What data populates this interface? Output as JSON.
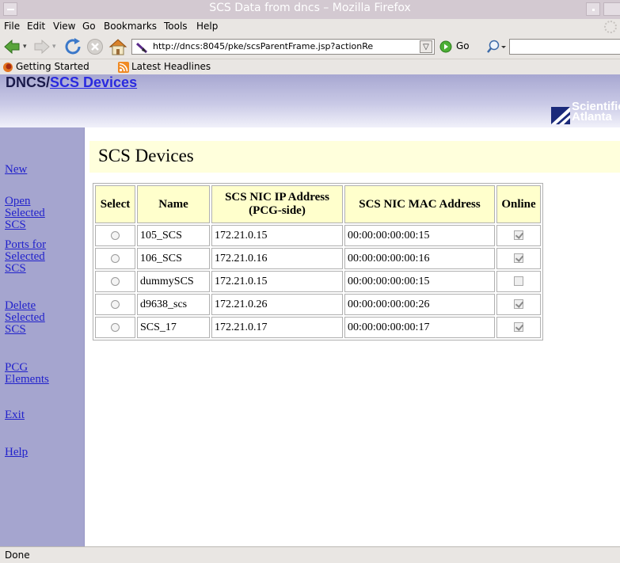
{
  "window": {
    "title": "SCS Data from dncs – Mozilla Firefox"
  },
  "menubar": {
    "items": [
      "File",
      "Edit",
      "View",
      "Go",
      "Bookmarks",
      "Tools",
      "Help"
    ]
  },
  "navbar": {
    "url": "http://dncs:8045/pke/scsParentFrame.jsp?actionRe",
    "go_label": "Go",
    "icons": [
      "back-arrow-icon",
      "forward-arrow-icon",
      "reload-icon",
      "stop-icon",
      "home-icon",
      "search-icon"
    ]
  },
  "bookmarks": {
    "items": [
      {
        "label": "Getting Started",
        "icon": "firefox-icon"
      },
      {
        "label": "Latest Headlines",
        "icon": "rss-feed-icon"
      }
    ]
  },
  "header": {
    "prefix": "DNCS/",
    "link": "SCS Devices",
    "brand": "Scientific Atlanta",
    "colors": {
      "band_top": "#a7a7d1",
      "band_mid": "#c9c9e6",
      "band_bottom": "#f1f1fa"
    }
  },
  "sidebar": {
    "items": [
      {
        "label": "New"
      },
      {
        "label": "Open\nSelected\nSCS"
      },
      {
        "label": "Ports for\nSelected\nSCS"
      },
      {
        "label": "Delete\nSelected\nSCS"
      },
      {
        "label": "PCG\nElements"
      },
      {
        "label": "Exit"
      },
      {
        "label": "Help"
      }
    ]
  },
  "main": {
    "title": "SCS Devices",
    "table": {
      "columns": [
        "Select",
        "Name",
        "SCS NIC IP Address (PCG-side)",
        "SCS NIC MAC Address",
        "Online"
      ],
      "rows": [
        {
          "name": "105_SCS",
          "ip": "172.21.0.15",
          "mac": "00:00:00:00:00:15",
          "online": true
        },
        {
          "name": "106_SCS",
          "ip": "172.21.0.16",
          "mac": "00:00:00:00:00:16",
          "online": true
        },
        {
          "name": "dummySCS",
          "ip": "172.21.0.15",
          "mac": "00:00:00:00:00:15",
          "online": false
        },
        {
          "name": "d9638_scs",
          "ip": "172.21.0.26",
          "mac": "00:00:00:00:00:26",
          "online": true
        },
        {
          "name": "SCS_17",
          "ip": "172.21.0.17",
          "mac": "00:00:00:00:00:17",
          "online": true
        }
      ]
    }
  },
  "statusbar": {
    "text": "Done"
  }
}
